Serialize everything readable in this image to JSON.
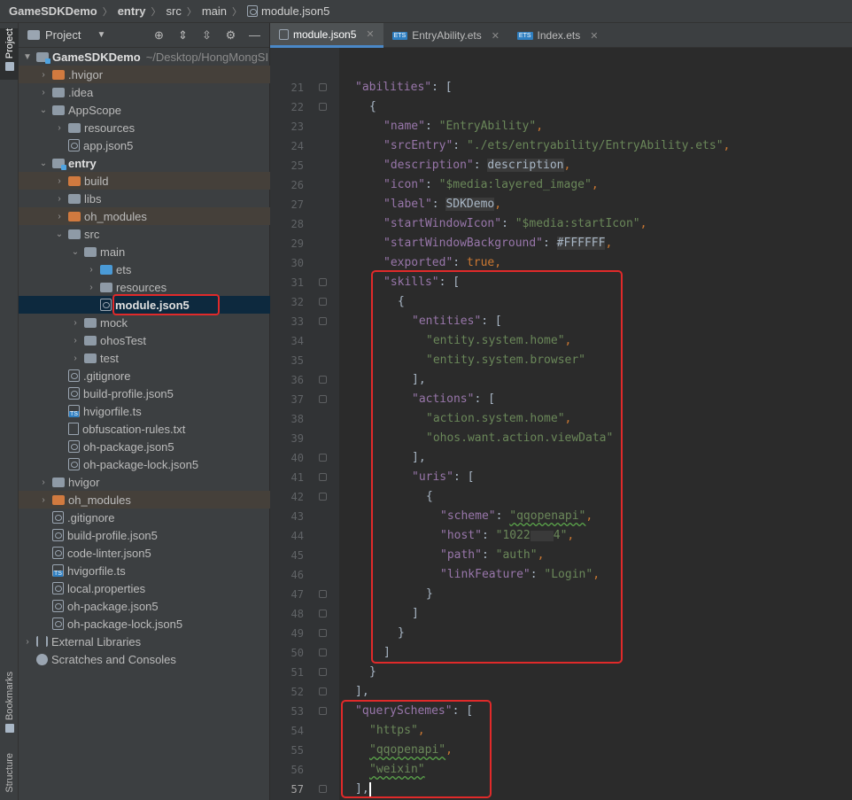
{
  "breadcrumb": [
    "GameSDKDemo",
    "entry",
    "src",
    "main",
    "module.json5"
  ],
  "toolstrip": {
    "project_label": "Project",
    "bookmarks_label": "Bookmarks",
    "structure_label": "Structure"
  },
  "project_panel": {
    "title": "Project",
    "root_name": "GameSDKDemo",
    "root_path": "~/Desktop/HongMongSI",
    "items": [
      {
        "label": ".hvigor"
      },
      {
        "label": ".idea"
      },
      {
        "label": "AppScope"
      },
      {
        "label": "resources"
      },
      {
        "label": "app.json5"
      },
      {
        "label": "entry"
      },
      {
        "label": "build"
      },
      {
        "label": "libs"
      },
      {
        "label": "oh_modules"
      },
      {
        "label": "src"
      },
      {
        "label": "main"
      },
      {
        "label": "ets"
      },
      {
        "label": "resources"
      },
      {
        "label": "module.json5"
      },
      {
        "label": "mock"
      },
      {
        "label": "ohosTest"
      },
      {
        "label": "test"
      },
      {
        "label": ".gitignore"
      },
      {
        "label": "build-profile.json5"
      },
      {
        "label": "hvigorfile.ts"
      },
      {
        "label": "obfuscation-rules.txt"
      },
      {
        "label": "oh-package.json5"
      },
      {
        "label": "oh-package-lock.json5"
      },
      {
        "label": "hvigor"
      },
      {
        "label": "oh_modules"
      },
      {
        "label": ".gitignore"
      },
      {
        "label": "build-profile.json5"
      },
      {
        "label": "code-linter.json5"
      },
      {
        "label": "hvigorfile.ts"
      },
      {
        "label": "local.properties"
      },
      {
        "label": "oh-package.json5"
      },
      {
        "label": "oh-package-lock.json5"
      },
      {
        "label": "External Libraries"
      },
      {
        "label": "Scratches and Consoles"
      }
    ]
  },
  "tabs": [
    {
      "label": "module.json5",
      "active": true
    },
    {
      "label": "EntryAbility.ets",
      "active": false
    },
    {
      "label": "Index.ets",
      "active": false
    }
  ],
  "editor": {
    "line_numbers": [
      "21",
      "22",
      "23",
      "24",
      "25",
      "26",
      "27",
      "28",
      "29",
      "30",
      "31",
      "32",
      "33",
      "34",
      "35",
      "36",
      "37",
      "38",
      "39",
      "40",
      "41",
      "42",
      "43",
      "44",
      "45",
      "46",
      "47",
      "48",
      "49",
      "50",
      "51",
      "52",
      "53",
      "54",
      "55",
      "56",
      "57"
    ],
    "current_line": "57",
    "code": {
      "l21": {
        "key": "\"abilities\"",
        "rest": ": ["
      },
      "l22": "{",
      "l23": {
        "key": "\"name\"",
        "val": "\"EntryAbility\""
      },
      "l24": {
        "key": "\"srcEntry\"",
        "val": "\"./ets/entryability/EntryAbility.ets\""
      },
      "l25": {
        "key": "\"description\"",
        "val": "description"
      },
      "l26": {
        "key": "\"icon\"",
        "val": "\"$media:layered_image\""
      },
      "l27": {
        "key": "\"label\"",
        "val": "SDKDemo"
      },
      "l28": {
        "key": "\"startWindowIcon\"",
        "val": "\"$media:startIcon\""
      },
      "l29": {
        "key": "\"startWindowBackground\"",
        "val": "#FFFFFF"
      },
      "l30": {
        "key": "\"exported\"",
        "val": "true"
      },
      "l31": {
        "key": "\"skills\"",
        "rest": ": ["
      },
      "l32": "{",
      "l33": {
        "key": "\"entities\"",
        "rest": ": ["
      },
      "l34": "\"entity.system.home\"",
      "l35": "\"entity.system.browser\"",
      "l36": "],",
      "l37": {
        "key": "\"actions\"",
        "rest": ": ["
      },
      "l38": "\"action.system.home\"",
      "l39": "\"ohos.want.action.viewData\"",
      "l40": "],",
      "l41": {
        "key": "\"uris\"",
        "rest": ": ["
      },
      "l42": "{",
      "l43": {
        "key": "\"scheme\"",
        "val": "\"qqopenapi\""
      },
      "l44": {
        "key": "\"host\"",
        "val_a": "\"1022",
        "val_b": "4\""
      },
      "l45": {
        "key": "\"path\"",
        "val": "\"auth\""
      },
      "l46": {
        "key": "\"linkFeature\"",
        "val": "\"Login\""
      },
      "l47": "}",
      "l48": "]",
      "l49": "}",
      "l50": "]",
      "l51": "}",
      "l52": "],",
      "l53": {
        "key": "\"querySchemes\"",
        "rest": ": ["
      },
      "l54": "\"https\"",
      "l55": "\"qqopenapi\"",
      "l56": "\"weixin\"",
      "l57": "],"
    }
  }
}
